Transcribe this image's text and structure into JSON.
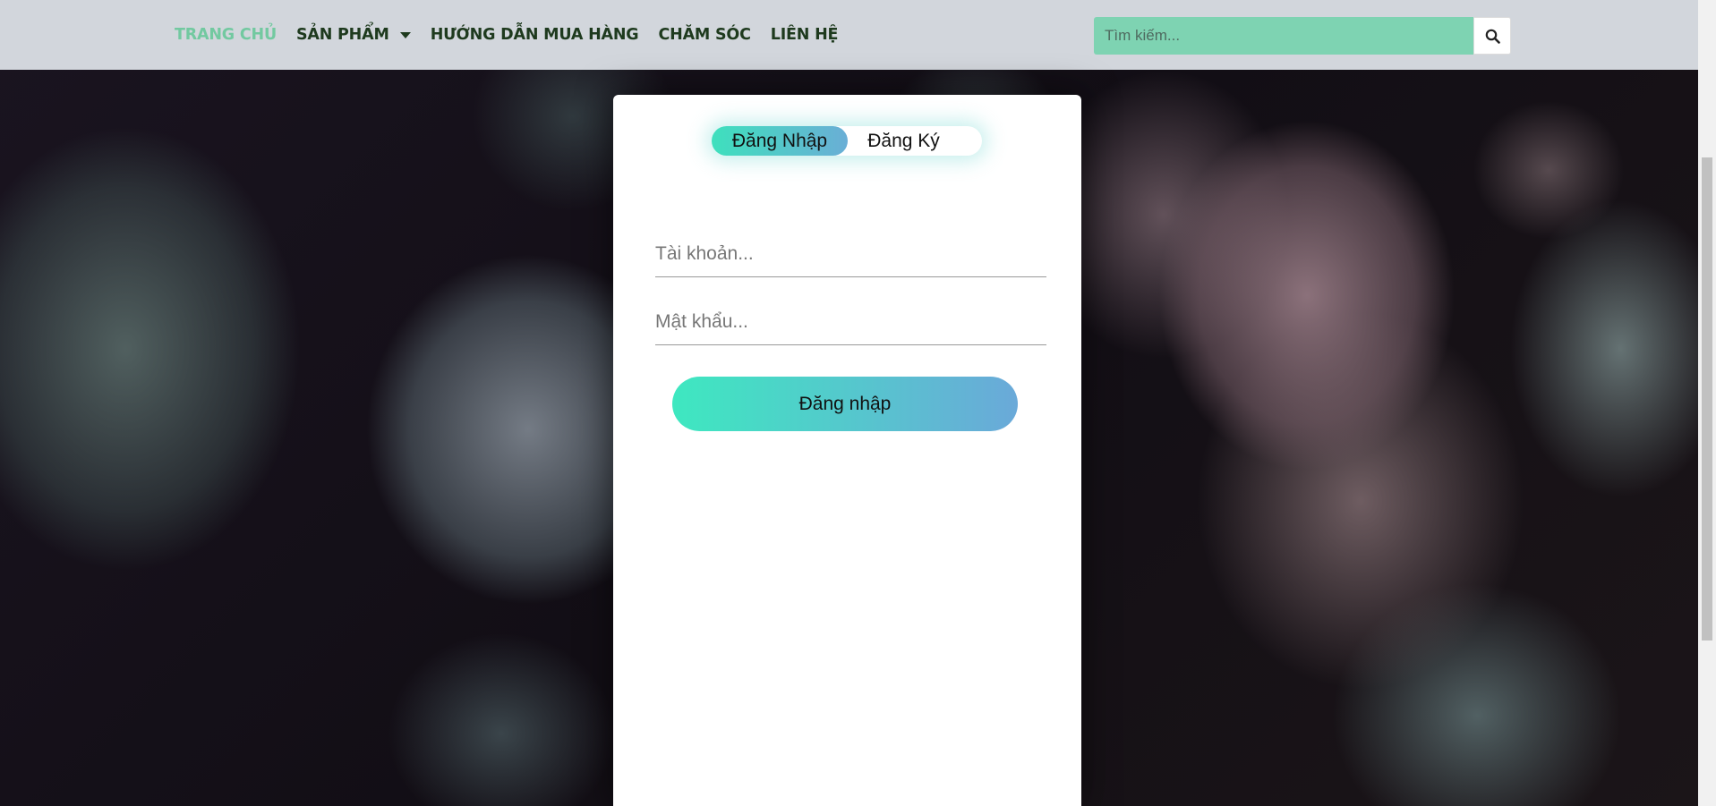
{
  "nav": {
    "items": [
      {
        "label": "TRANG CHỦ",
        "active": true
      },
      {
        "label": "SẢN PHẨM",
        "dropdown": true
      },
      {
        "label": "HƯỚNG DẪN MUA HÀNG"
      },
      {
        "label": "CHĂM SÓC"
      },
      {
        "label": "LIÊN HỆ"
      }
    ]
  },
  "search": {
    "placeholder": "Tìm kiếm...",
    "icon": "search-icon"
  },
  "auth": {
    "tabs": {
      "login": "Đăng Nhập",
      "register": "Đăng Ký"
    },
    "username_placeholder": "Tài khoản...",
    "password_placeholder": "Mật khẩu...",
    "submit_label": "Đăng nhập"
  },
  "colors": {
    "header_bg": "#d2d6dc",
    "nav_text": "#1e3a1e",
    "nav_active": "#72c9a0",
    "search_bg": "#7ed3b2",
    "gradient_start": "#3ee8c0",
    "gradient_end": "#6aa9d9"
  }
}
